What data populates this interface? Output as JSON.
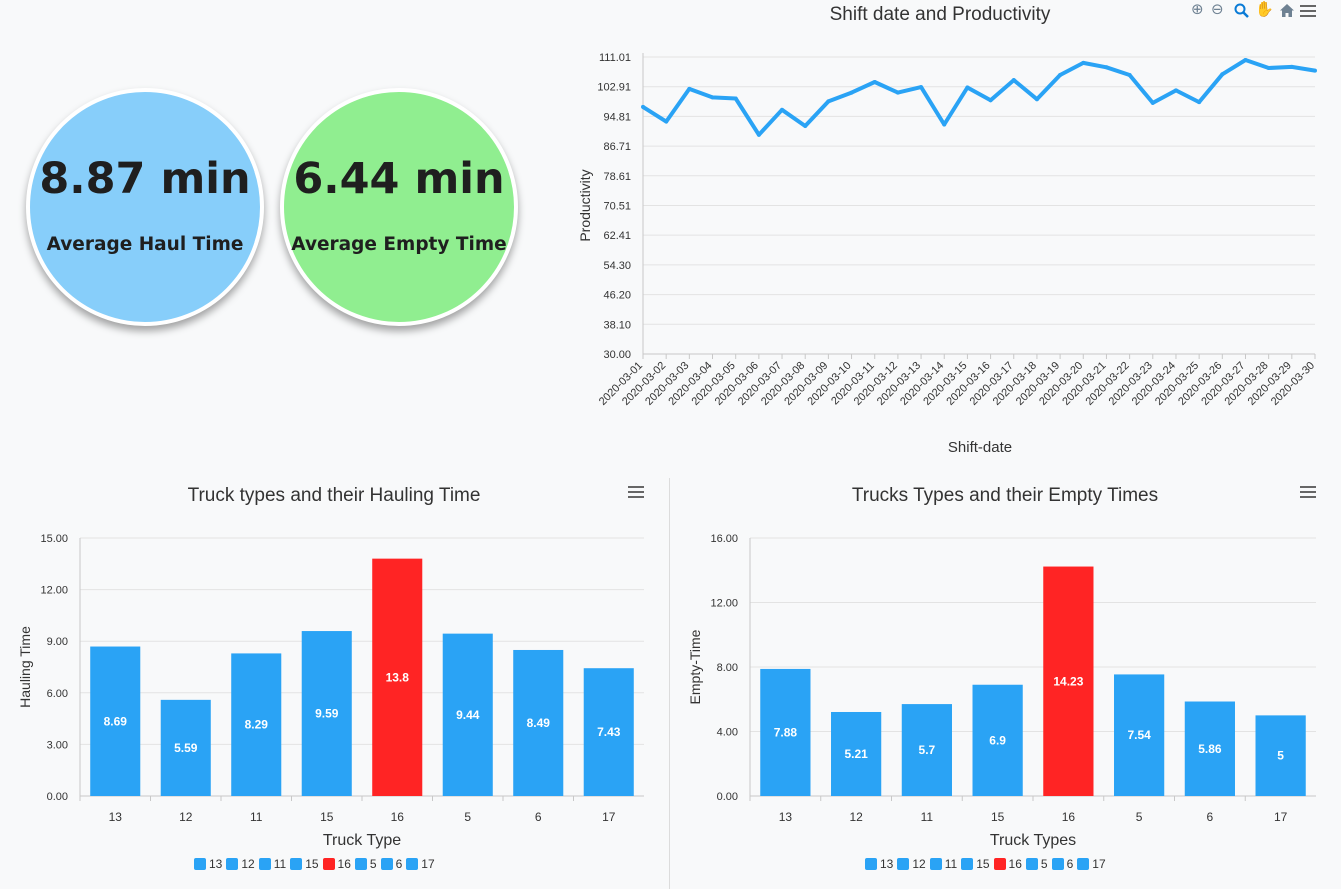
{
  "kpis": {
    "haul": {
      "value": "8.87 min",
      "label": "Average Haul Time",
      "color": "#87cefa"
    },
    "empty": {
      "value": "6.44 min",
      "label": "Average Empty Time",
      "color": "#90ee90"
    }
  },
  "colors": {
    "primary": "#2aa3f5",
    "highlight": "#ff2424"
  },
  "chart_data": [
    {
      "type": "line",
      "title": "Shift date and Productivity",
      "xlabel": "Shift-date",
      "ylabel": "Productivity",
      "ylim": [
        30.0,
        111.01
      ],
      "yticks": [
        "30.00",
        "38.10",
        "46.20",
        "54.30",
        "62.41",
        "70.51",
        "78.61",
        "86.71",
        "94.81",
        "102.91",
        "111.01"
      ],
      "x": [
        "2020-03-01",
        "2020-03-02",
        "2020-03-03",
        "2020-03-04",
        "2020-03-05",
        "2020-03-06",
        "2020-03-07",
        "2020-03-08",
        "2020-03-09",
        "2020-03-10",
        "2020-03-11",
        "2020-03-12",
        "2020-03-13",
        "2020-03-14",
        "2020-03-15",
        "2020-03-16",
        "2020-03-17",
        "2020-03-18",
        "2020-03-19",
        "2020-03-20",
        "2020-03-21",
        "2020-03-22",
        "2020-03-23",
        "2020-03-24",
        "2020-03-25",
        "2020-03-26",
        "2020-03-27",
        "2020-03-28",
        "2020-03-29",
        "2020-03-30"
      ],
      "values": [
        97.4,
        93.4,
        102.3,
        100.0,
        99.7,
        89.8,
        96.6,
        92.2,
        98.9,
        101.3,
        104.2,
        101.3,
        102.8,
        92.6,
        102.7,
        99.2,
        104.7,
        99.5,
        106.1,
        109.4,
        108.2,
        106.1,
        98.5,
        101.9,
        98.7,
        106.3,
        110.2,
        108.0,
        108.3,
        107.3
      ],
      "color": "#2aa3f5",
      "grid": true,
      "toolbar": [
        "zoom-in-icon",
        "zoom-out-icon",
        "zoom-selection-icon",
        "pan-hand-icon",
        "home-reset-icon",
        "menu-icon"
      ]
    },
    {
      "type": "bar",
      "title": "Truck types and their Hauling Time",
      "xlabel": "Truck Type",
      "ylabel": "Hauling Time",
      "ylim": [
        0,
        15
      ],
      "yticks": [
        "0.00",
        "3.00",
        "6.00",
        "9.00",
        "12.00",
        "15.00"
      ],
      "categories": [
        "13",
        "12",
        "11",
        "15",
        "16",
        "5",
        "6",
        "17"
      ],
      "values": [
        8.69,
        5.59,
        8.29,
        9.59,
        13.8,
        9.44,
        8.49,
        7.43
      ],
      "labels": [
        "8.69",
        "5.59",
        "8.29",
        "9.59",
        "13.8",
        "9.44",
        "8.49",
        "7.43"
      ],
      "colors": [
        "#2aa3f5",
        "#2aa3f5",
        "#2aa3f5",
        "#2aa3f5",
        "#ff2424",
        "#2aa3f5",
        "#2aa3f5",
        "#2aa3f5"
      ],
      "legend": [
        "13",
        "12",
        "11",
        "15",
        "16",
        "5",
        "6",
        "17"
      ],
      "legend_position": "bottom"
    },
    {
      "type": "bar",
      "title": "Trucks Types and their Empty Times",
      "xlabel": "Truck Types",
      "ylabel": "Empty-Time",
      "ylim": [
        0,
        16
      ],
      "yticks": [
        "0.00",
        "4.00",
        "8.00",
        "12.00",
        "16.00"
      ],
      "categories": [
        "13",
        "12",
        "11",
        "15",
        "16",
        "5",
        "6",
        "17"
      ],
      "values": [
        7.88,
        5.21,
        5.7,
        6.9,
        14.23,
        7.54,
        5.86,
        5
      ],
      "labels": [
        "7.88",
        "5.21",
        "5.7",
        "6.9",
        "14.23",
        "7.54",
        "5.86",
        "5"
      ],
      "colors": [
        "#2aa3f5",
        "#2aa3f5",
        "#2aa3f5",
        "#2aa3f5",
        "#ff2424",
        "#2aa3f5",
        "#2aa3f5",
        "#2aa3f5"
      ],
      "legend": [
        "13",
        "12",
        "11",
        "15",
        "16",
        "5",
        "6",
        "17"
      ],
      "legend_position": "bottom"
    }
  ]
}
